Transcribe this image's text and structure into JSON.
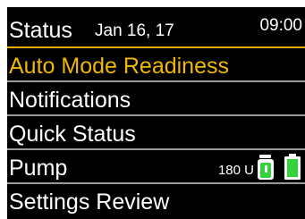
{
  "header": {
    "title": "Status",
    "date": "Jan 16, 17",
    "time": "09:00"
  },
  "menu": {
    "items": [
      {
        "label": "Auto Mode Readiness"
      },
      {
        "label": "Notifications"
      },
      {
        "label": "Quick Status"
      },
      {
        "label": "Pump"
      },
      {
        "label": "Settings Review"
      }
    ]
  },
  "pump": {
    "reservoir_text": "180 U",
    "reservoir_icon": "reservoir-icon",
    "battery_icon": "battery-icon"
  },
  "colors": {
    "background": "#000000",
    "highlight": "#f0b800",
    "highlight_line": "#e2a800",
    "divider": "#9a9a9a",
    "text": "#ffffff",
    "icon_green": "#35d33b"
  }
}
